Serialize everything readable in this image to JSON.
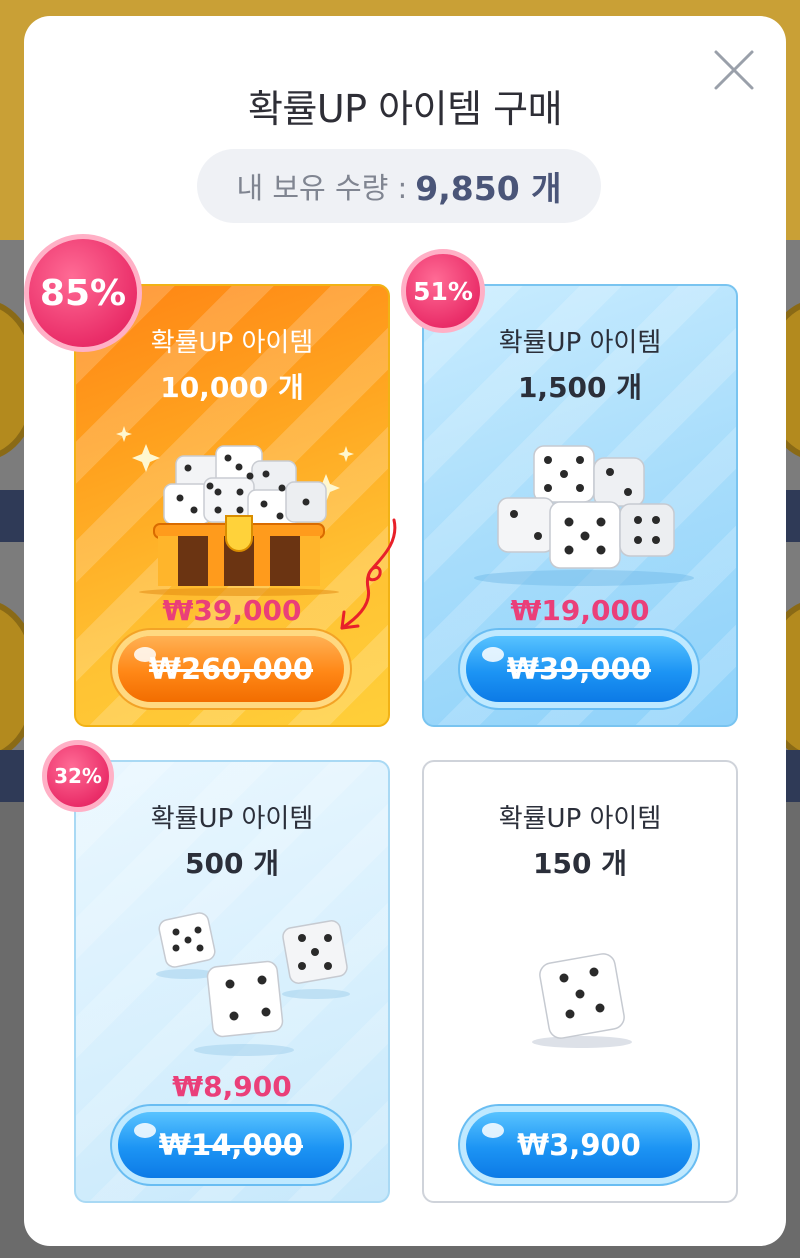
{
  "modal": {
    "title": "확률UP 아이템 구매",
    "holdings": {
      "label": "내 보유 수량 :",
      "value": "9,850 개"
    },
    "close_icon": "close-icon"
  },
  "items": [
    {
      "badge": "85%",
      "name": "확률UP 아이템",
      "qty": "10,000 개",
      "sale_price": "₩39,000",
      "button_label": "₩260,000",
      "button_strike": true,
      "theme": "orange",
      "art": "treasure-chest-dice"
    },
    {
      "badge": "51%",
      "name": "확률UP 아이템",
      "qty": "1,500 개",
      "sale_price": "₩19,000",
      "button_label": "₩39,000",
      "button_strike": true,
      "theme": "blue",
      "art": "dice-pile"
    },
    {
      "badge": "32%",
      "name": "확률UP 아이템",
      "qty": "500 개",
      "sale_price": "₩8,900",
      "button_label": "₩14,000",
      "button_strike": true,
      "theme": "light-blue",
      "art": "three-dice"
    },
    {
      "name": "확률UP 아이템",
      "qty": "150 개",
      "button_label": "₩3,900",
      "button_strike": false,
      "theme": "white",
      "art": "single-die"
    }
  ],
  "colors": {
    "accent_pink": "#ea3f79",
    "orange": "#ff8716",
    "blue": "#1c94f4"
  }
}
